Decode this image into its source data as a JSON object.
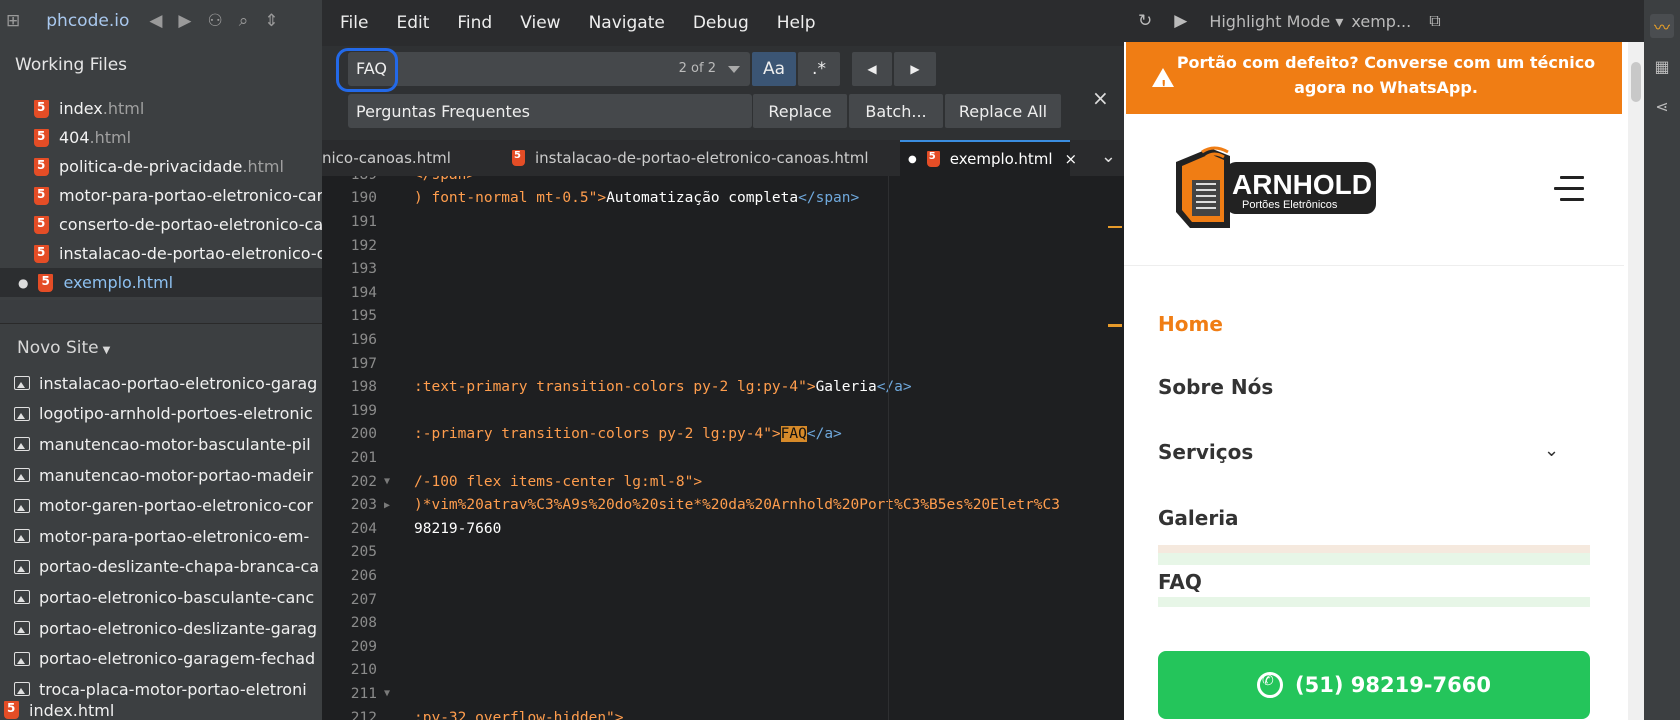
{
  "sidebar": {
    "project": "phcode.io",
    "working_files_title": "Working Files",
    "working_files": [
      {
        "name": "index",
        "ext": ".html"
      },
      {
        "name": "404",
        "ext": ".html"
      },
      {
        "name": "politica-de-privacidade",
        "ext": ".html"
      },
      {
        "name": "motor-para-portao-eletronico-car",
        "ext": ""
      },
      {
        "name": "conserto-de-portao-eletronico-ca",
        "ext": ""
      },
      {
        "name": "instalacao-de-portao-eletronico-c",
        "ext": ""
      },
      {
        "name": "exemplo.html",
        "ext": ""
      }
    ],
    "tree_title": "Novo Site",
    "tree_items": [
      "instalacao-portao-eletronico-garag",
      "logotipo-arnhold-portoes-eletronic",
      "manutencao-motor-basculante-pil",
      "manutencao-motor-portao-madeir",
      "motor-garen-portao-eletronico-cor",
      "motor-para-portao-eletronico-em-",
      "portao-deslizante-chapa-branca-ca",
      "portao-eletronico-basculante-canc",
      "portao-eletronico-deslizante-garag",
      "portao-eletronico-garagem-fechad",
      "troca-placa-motor-portao-eletroni"
    ],
    "tree_bottom": "index.html"
  },
  "menu": [
    "File",
    "Edit",
    "Find",
    "View",
    "Navigate",
    "Debug",
    "Help"
  ],
  "find": {
    "query": "FAQ",
    "count": "2 of 2",
    "case_label": "Aa",
    "regex_label": ".*",
    "prev": "◀",
    "next": "▶",
    "replace_value": "Perguntas Frequentes",
    "replace": "Replace",
    "batch": "Batch...",
    "replace_all": "Replace All",
    "close": "×"
  },
  "tabs": [
    {
      "label": "nico-canoas.html"
    },
    {
      "label": "instalacao-de-portao-eletronico-canoas.html"
    },
    {
      "label": "exemplo.html",
      "active": true
    }
  ],
  "code_lines": [
    {
      "n": "189",
      "pre": "</span>",
      "w": "",
      "post": "",
      "fold": ""
    },
    {
      "n": "190",
      "pre": ") font-normal mt-0.5\">",
      "w": "Automatização completa",
      "post": "</span>",
      "fold": ""
    },
    {
      "n": "191",
      "pre": "",
      "w": "",
      "post": "",
      "fold": ""
    },
    {
      "n": "192",
      "pre": "",
      "w": "",
      "post": "",
      "fold": ""
    },
    {
      "n": "193",
      "pre": "",
      "w": "",
      "post": "",
      "fold": ""
    },
    {
      "n": "194",
      "pre": "",
      "w": "",
      "post": "",
      "fold": ""
    },
    {
      "n": "195",
      "pre": "",
      "w": "",
      "post": "",
      "fold": ""
    },
    {
      "n": "196",
      "pre": "",
      "w": "",
      "post": "",
      "fold": ""
    },
    {
      "n": "197",
      "pre": "",
      "w": "",
      "post": "",
      "fold": ""
    },
    {
      "n": "198",
      "pre": ":text-primary transition-colors py-2 lg:py-4\">",
      "w": "Galeria",
      "post": "</a>",
      "fold": ""
    },
    {
      "n": "199",
      "pre": "",
      "w": "",
      "post": "",
      "fold": ""
    },
    {
      "n": "200",
      "pre": ":-primary transition-colors py-2 lg:py-4\">",
      "w": "",
      "hl": "FAQ",
      "post": "</a>",
      "fold": ""
    },
    {
      "n": "201",
      "pre": "",
      "w": "",
      "post": "",
      "fold": ""
    },
    {
      "n": "202",
      "pre": "/-100 flex items-center lg:ml-8\">",
      "w": "",
      "post": "",
      "fold": "▼"
    },
    {
      "n": "203",
      "pre": ")*vim%20atrav%C3%A9s%20do%20site*%20da%20Arnhold%20Port%C3%B5es%20Eletr%C3",
      "w": "",
      "post": "",
      "fold": "▶"
    },
    {
      "n": "204",
      "pre": "",
      "w": "98219-7660",
      "post": "",
      "fold": ""
    },
    {
      "n": "205",
      "pre": "",
      "w": "",
      "post": "",
      "fold": ""
    },
    {
      "n": "206",
      "pre": "",
      "w": "",
      "post": "",
      "fold": ""
    },
    {
      "n": "207",
      "pre": "",
      "w": "",
      "post": "",
      "fold": ""
    },
    {
      "n": "208",
      "pre": "",
      "w": "",
      "post": "",
      "fold": ""
    },
    {
      "n": "209",
      "pre": "",
      "w": "",
      "post": "",
      "fold": ""
    },
    {
      "n": "210",
      "pre": "",
      "w": "",
      "post": "",
      "fold": ""
    },
    {
      "n": "211",
      "pre": "",
      "w": "",
      "post": "",
      "fold": "▼"
    },
    {
      "n": "212",
      "pre": ":py-32 overflow-hidden\">",
      "w": "",
      "post": "",
      "fold": ""
    }
  ],
  "preview": {
    "mode": "Highlight Mode",
    "file": "xemp...",
    "banner": "Portão com defeito? Converse com um técnico agora no WhatsApp.",
    "logo_name": "ARNHOLD",
    "logo_sub": "Portões Eletrônicos",
    "nav": [
      "Home",
      "Sobre Nós",
      "Serviços",
      "Galeria",
      "FAQ"
    ],
    "whatsapp": "(51) 98219-7660",
    "accent": "#f07d14",
    "green": "#24c55b"
  }
}
